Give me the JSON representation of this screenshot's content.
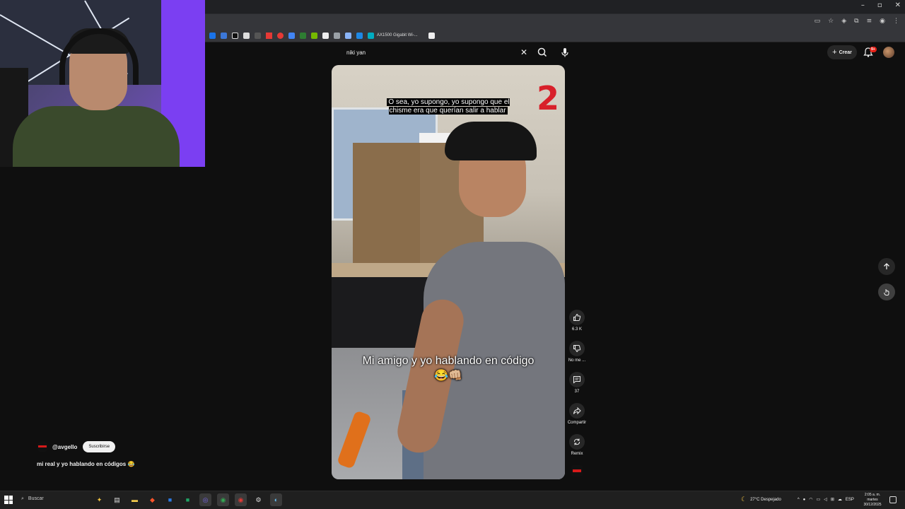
{
  "browser": {
    "bookmark_label": "AX1500 Gigabit Wi-...",
    "window_controls": [
      "–",
      "▫",
      "✕"
    ]
  },
  "youtube": {
    "search": {
      "value": "niki yan"
    },
    "header": {
      "create_label": "Crear",
      "notification_count": "9+"
    },
    "video": {
      "caption_top": "O sea, yo supongo, yo supongo que el chisme era que querían salir a hablar",
      "caption_main": "Mi amigo y yo hablando en código 😂👊🏼",
      "overlay_number": "2"
    },
    "actions": {
      "like_count": "6.3 K",
      "dislike_label": "No me ...",
      "comment_count": "37",
      "share_label": "Compartir",
      "remix_label": "Remix"
    },
    "channel": {
      "handle": "@avgello",
      "subscribe_label": "Suscribirse",
      "description": "mi real y yo hablando en códigos 😂"
    }
  },
  "taskbar": {
    "search_label": "Buscar",
    "weather": "27°C  Despejado",
    "language": "ESP",
    "time": "2:05 a. m.",
    "day": "martes",
    "date": "30/12/2025"
  }
}
